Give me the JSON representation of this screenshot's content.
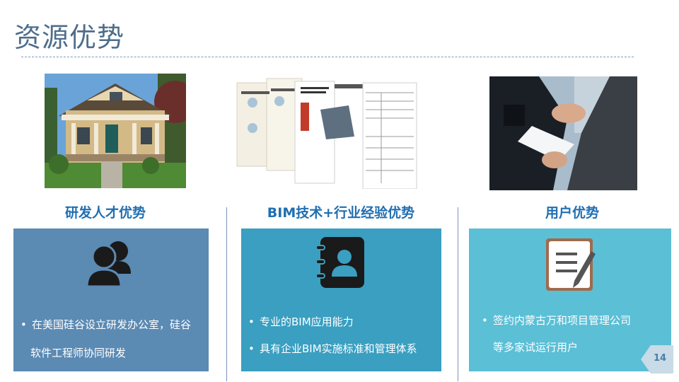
{
  "title": "资源优势",
  "page_number": "14",
  "columns": [
    {
      "heading": "研发人才优势",
      "icon": "users-icon",
      "bullets": [
        "在美国硅谷设立研发办公室，硅谷",
        "软件工程师协同研发"
      ]
    },
    {
      "heading": "BIM技术+行业经验优势",
      "icon": "contact-book-icon",
      "bullets": [
        "专业的BIM应用能力",
        "具有企业BIM实施标准和管理体系"
      ]
    },
    {
      "heading": "用户优势",
      "icon": "document-edit-icon",
      "bullets": [
        "签约内蒙古万和项目管理公司",
        "等多家试运行用户"
      ]
    }
  ],
  "colors": {
    "title": "#4e6d8c",
    "heading": "#1f6fb2",
    "card_1": "#5b8ab3",
    "card_2": "#3a9fc1",
    "card_3": "#5bbfd6",
    "page_badge": "#c8dbe6"
  }
}
